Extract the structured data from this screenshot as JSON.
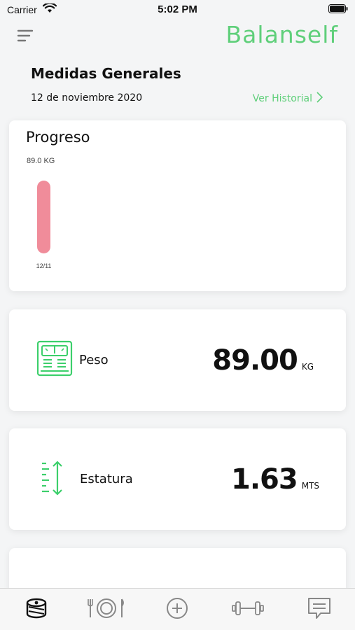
{
  "status_bar": {
    "carrier": "Carrier",
    "time": "5:02 PM"
  },
  "header": {
    "brand": "Balanself",
    "menu_icon": "hamburger-menu-icon"
  },
  "page": {
    "title": "Medidas Generales",
    "date": "12 de noviembre 2020",
    "history_link": "Ver Historial"
  },
  "progress_card": {
    "title": "Progreso",
    "chart_data": {
      "type": "bar",
      "categories": [
        "12/11"
      ],
      "values": [
        89.0
      ],
      "value_label": "89.0 KG",
      "bar_color": "#f08c9a"
    }
  },
  "metrics": [
    {
      "label": "Peso",
      "value": "89.00",
      "unit": "KG",
      "icon": "weight-scale-icon"
    },
    {
      "label": "Estatura",
      "value": "1.63",
      "unit": "MTS",
      "icon": "height-ruler-icon"
    }
  ],
  "tabbar": {
    "items": [
      {
        "icon": "measuring-tape-icon",
        "active": true
      },
      {
        "icon": "plate-cutlery-icon",
        "active": false
      },
      {
        "icon": "add-circle-icon",
        "active": false
      },
      {
        "icon": "dumbbell-icon",
        "active": false
      },
      {
        "icon": "chat-message-icon",
        "active": false
      }
    ]
  },
  "colors": {
    "accent": "#5fcf7a",
    "bar": "#f08c9a",
    "background": "#f4f5f6"
  }
}
